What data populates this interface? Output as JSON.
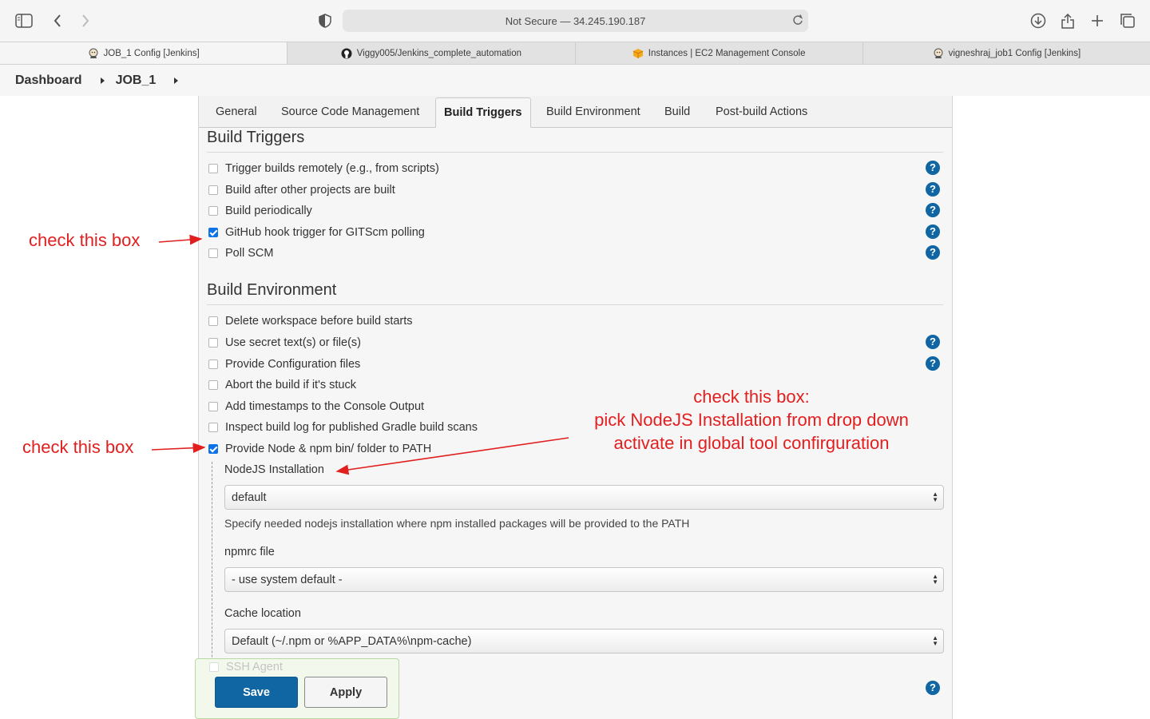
{
  "browser": {
    "address_text": "Not Secure — 34.245.190.187",
    "tabs": [
      {
        "label": "JOB_1 Config [Jenkins]"
      },
      {
        "label": "Viggy005/Jenkins_complete_automation"
      },
      {
        "label": "Instances | EC2 Management Console"
      },
      {
        "label": "vigneshraj_job1 Config [Jenkins]"
      }
    ]
  },
  "breadcrumb": {
    "items": [
      "Dashboard",
      "JOB_1"
    ]
  },
  "config_tabs": [
    "General",
    "Source Code Management",
    "Build Triggers",
    "Build Environment",
    "Build",
    "Post-build Actions"
  ],
  "build_triggers": {
    "title": "Build Triggers",
    "items": [
      {
        "label": "Trigger builds remotely (e.g., from scripts)"
      },
      {
        "label": "Build after other projects are built"
      },
      {
        "label": "Build periodically"
      },
      {
        "label": "GitHub hook trigger for GITScm polling"
      },
      {
        "label": "Poll SCM"
      }
    ]
  },
  "build_environment": {
    "title": "Build Environment",
    "items": [
      {
        "label": "Delete workspace before build starts"
      },
      {
        "label": "Use secret text(s) or file(s)"
      },
      {
        "label": "Provide Configuration files"
      },
      {
        "label": "Abort the build if it's stuck"
      },
      {
        "label": "Add timestamps to the Console Output"
      },
      {
        "label": "Inspect build log for published Gradle build scans"
      },
      {
        "label": "Provide Node & npm bin/ folder to PATH"
      }
    ],
    "nodejs": {
      "label": "NodeJS Installation",
      "value": "default",
      "hint": "Specify needed nodejs installation where npm installed packages will be provided to the PATH"
    },
    "npmrc": {
      "label": "npmrc file",
      "value": "- use system default -"
    },
    "cache": {
      "label": "Cache location",
      "value": "Default (~/.npm or %APP_DATA%\\npm-cache)"
    },
    "ssh_agent_label": "SSH Agent"
  },
  "buttons": {
    "save": "Save",
    "apply": "Apply"
  },
  "annotations": {
    "check1": "check this box",
    "check2": "check this box",
    "note_line1": "check this box:",
    "note_line2": "pick NodeJS Installation from drop down",
    "note_line3": "activate in global tool confirguration"
  },
  "colors": {
    "annotation": "#e21f1f",
    "jenkins_blue": "#1065a3",
    "checkbox_checked": "#0b73e6"
  },
  "help_glyph": "?"
}
